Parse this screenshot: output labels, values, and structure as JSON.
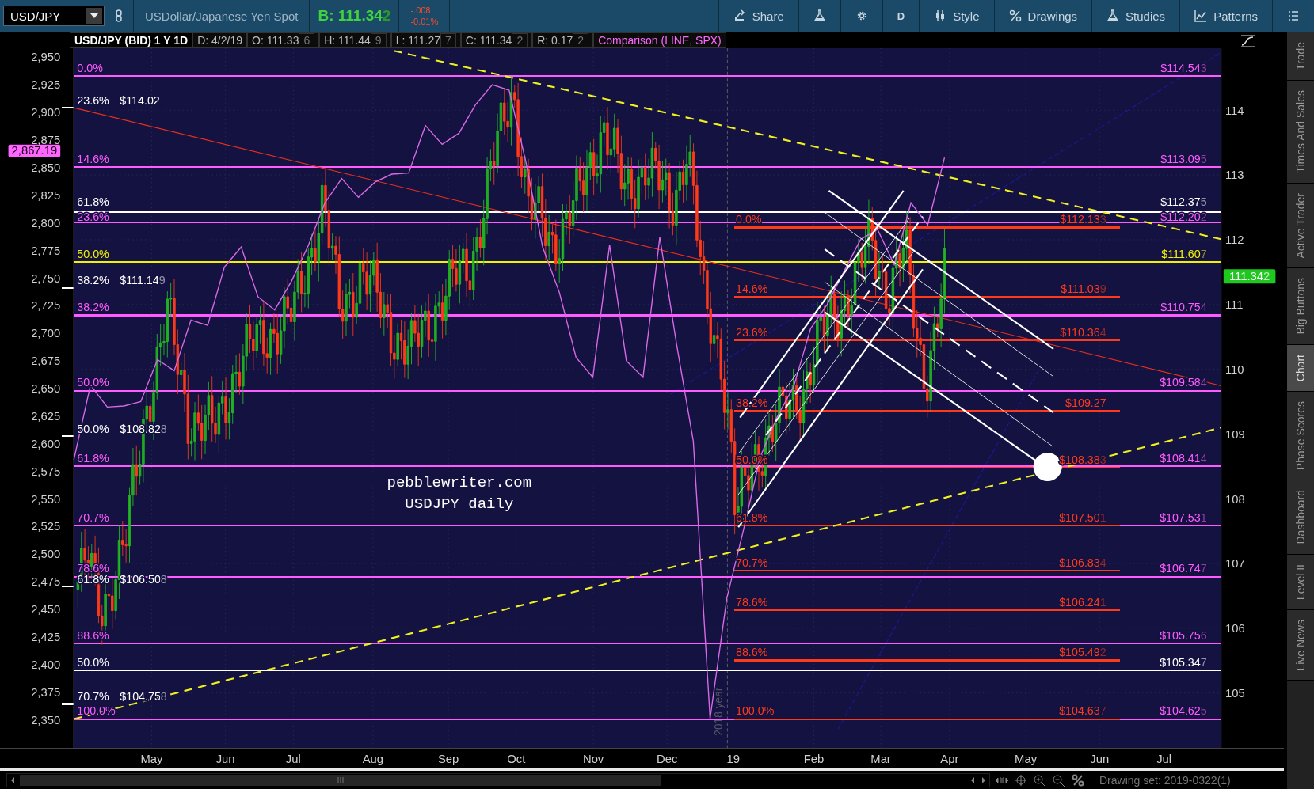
{
  "toolbar": {
    "symbol": "USD/JPY",
    "description": "USDollar/Japanese Yen Spot",
    "bid": {
      "text": "B: 111.34",
      "tail": "2"
    },
    "change": "-.008",
    "change_percent": "-0.01%",
    "buttons": [
      {
        "kind": "share",
        "label": "Share"
      },
      {
        "kind": "flask"
      },
      {
        "kind": "gear"
      },
      {
        "kind": "text",
        "label": "D"
      },
      {
        "kind": "style",
        "label": "Style"
      },
      {
        "kind": "drawings",
        "label": "Drawings"
      },
      {
        "kind": "studies",
        "label": "Studies"
      },
      {
        "kind": "patterns",
        "label": "Patterns"
      },
      {
        "kind": "menu"
      }
    ]
  },
  "header": {
    "title": "USD/JPY (BID) 1 Y 1D",
    "fields": [
      {
        "text": "D: 4/2/19"
      },
      {
        "text": "O: 111.33",
        "tail": "6"
      },
      {
        "text": "H: 111.44",
        "tail": "9"
      },
      {
        "text": "L: 111.27",
        "tail": "7"
      },
      {
        "text": "C: 111.34",
        "tail": "2"
      },
      {
        "text": "R: 0.17",
        "tail": "2"
      }
    ],
    "comparison": "Comparison (LINE, SPX)"
  },
  "chart": {
    "chart_data": {
      "type": "line",
      "ylim": [
        2324,
        2958
      ],
      "series": [
        {
          "color": "#d86ae6",
          "values": [
            2585,
            2653,
            2633,
            2634,
            2638,
            2676,
            2666,
            2712,
            2707,
            2760,
            2778,
            2733,
            2721,
            2747,
            2779,
            2818,
            2840,
            2823,
            2837,
            2844,
            2845,
            2888,
            2871,
            2881,
            2907,
            2925,
            2920,
            2855,
            2778,
            2737,
            2678,
            2660,
            2780,
            2675,
            2660,
            2787,
            2690,
            2602,
            2351,
            2460,
            2522,
            2588,
            2624,
            2652,
            2704,
            2726,
            2756,
            2785,
            2794,
            2762,
            2818,
            2798,
            2859
          ]
        }
      ],
      "yticks": [
        {
          "value": 2950,
          "label": "2,950"
        },
        {
          "value": 2925,
          "label": "2,925"
        },
        {
          "value": 2900,
          "label": "2,900"
        },
        {
          "value": 2875,
          "label": "2,875"
        },
        {
          "value": 2850,
          "label": "2,850"
        },
        {
          "value": 2825,
          "label": "2,825"
        },
        {
          "value": 2800,
          "label": "2,800"
        },
        {
          "value": 2775,
          "label": "2,775"
        },
        {
          "value": 2750,
          "label": "2,750"
        },
        {
          "value": 2725,
          "label": "2,725"
        },
        {
          "value": 2700,
          "label": "2,700"
        },
        {
          "value": 2675,
          "label": "2,675"
        },
        {
          "value": 2650,
          "label": "2,650"
        },
        {
          "value": 2625,
          "label": "2,625"
        },
        {
          "value": 2600,
          "label": "2,600"
        },
        {
          "value": 2575,
          "label": "2,575"
        },
        {
          "value": 2550,
          "label": "2,550"
        },
        {
          "value": 2525,
          "label": "2,525"
        },
        {
          "value": 2500,
          "label": "2,500"
        },
        {
          "value": 2475,
          "label": "2,475"
        },
        {
          "value": 2450,
          "label": "2,450"
        },
        {
          "value": 2425,
          "label": "2,425"
        },
        {
          "value": 2400,
          "label": "2,400"
        },
        {
          "value": 2375,
          "label": "2,375"
        },
        {
          "value": 2350,
          "label": "2,350"
        }
      ]
    },
    "right_axis_ticks": [
      "114",
      "113",
      "112",
      "111",
      "110",
      "109",
      "108",
      "107",
      "106",
      "105"
    ],
    "left_badge": {
      "text": "2,867.19"
    },
    "right_badge": {
      "text": "111.34",
      "tail": "2"
    },
    "date_labels": [
      "May",
      "Jun",
      "Jul",
      "Aug",
      "Sep",
      "Oct",
      "Nov",
      "Dec",
      "19",
      "Feb",
      "Mar",
      "Apr",
      "May",
      "Jun",
      "Jul"
    ],
    "notes": [
      "pebblewriter.com",
      "USDJPY daily"
    ],
    "year_marker": "2018 year",
    "fib_sets": [
      {
        "kind": "range",
        "color": "#ff5cff",
        "levels": [
          {
            "percent": "0.0%",
            "price": "$114.54",
            "tail": "3"
          },
          {
            "percent": "14.6%",
            "price": "$113.09",
            "tail": "5"
          },
          {
            "percent": "23.6%",
            "price": "$112.20",
            "tail": "2"
          },
          {
            "percent": "38.2%",
            "price": "$110.75",
            "tail": "4"
          },
          {
            "percent": "50.0%",
            "price": "$109.58",
            "tail": "4"
          },
          {
            "percent": "61.8%",
            "price": "$108.41",
            "tail": "4"
          },
          {
            "percent": "70.7%",
            "price": "$107.53",
            "tail": "1"
          },
          {
            "percent": "78.6%",
            "price": "$106.74",
            "tail": "7"
          },
          {
            "percent": "88.6%",
            "price": "$105.75",
            "tail": "6"
          },
          {
            "percent": "100.0%",
            "price": "$104.62",
            "tail": "5"
          }
        ]
      },
      {
        "kind": "range",
        "color": "#ff3a1a",
        "levels": [
          {
            "percent": "0.0%",
            "price": "$112.13",
            "tail": "3"
          },
          {
            "percent": "14.6%",
            "price": "$111.03",
            "tail": "9"
          },
          {
            "percent": "23.6%",
            "price": "$110.36",
            "tail": "4"
          },
          {
            "percent": "38.2%",
            "price": "$109.27"
          },
          {
            "percent": "50.0%",
            "price": "$108.38",
            "tail": "3"
          },
          {
            "percent": "61.8%",
            "price": "$107.50",
            "tail": "1"
          },
          {
            "percent": "70.7%",
            "price": "$106.83",
            "tail": "4"
          },
          {
            "percent": "78.6%",
            "price": "$106.24",
            "tail": "1"
          },
          {
            "percent": "88.6%",
            "price": "$105.49",
            "tail": "2"
          },
          {
            "percent": "100.0%",
            "price": "$104.63",
            "tail": "7"
          }
        ]
      },
      {
        "kind": "mixed",
        "levels": [
          {
            "kind": "tick",
            "color": "#ffffff",
            "percent": "23.6%",
            "price": "$114.02"
          },
          {
            "kind": "full",
            "color": "#ffffff",
            "percent": "61.8%",
            "price": "$112.37",
            "tail": "5"
          },
          {
            "kind": "full",
            "color": "#f2f200",
            "percent": "50.0%",
            "price": "$111.60",
            "tail": "7"
          },
          {
            "kind": "tick",
            "color": "#ffffff",
            "percent": "38.2%",
            "price": "$111.14",
            "tail": "9"
          },
          {
            "kind": "tick",
            "color": "#ffffff",
            "percent": "50.0%",
            "price": "$108.82",
            "tail": "8"
          },
          {
            "kind": "tick",
            "color": "#ffffff",
            "percent": "61.8%",
            "price": "$106.50",
            "tail": "8"
          },
          {
            "kind": "full",
            "color": "#ffffff",
            "percent": "50.0%",
            "price": "$105.34",
            "tail": "7"
          },
          {
            "kind": "tick",
            "color": "#ffffff",
            "percent": "70.7%",
            "price": "$104.75",
            "tail": "8"
          }
        ]
      }
    ]
  },
  "side_tabs": [
    {
      "label": "Trade",
      "selected": false
    },
    {
      "label": "Times And Sales",
      "selected": false
    },
    {
      "label": "Active Trader",
      "selected": false
    },
    {
      "label": "Big Buttons",
      "selected": false
    },
    {
      "label": "Chart",
      "selected": true
    },
    {
      "label": "Phase Scores",
      "selected": false
    },
    {
      "label": "Dashboard",
      "selected": false
    },
    {
      "label": "Level II",
      "selected": false
    },
    {
      "label": "Live News",
      "selected": false
    }
  ],
  "footer": {
    "drawing_set": "Drawing set: 2019-0322(1)"
  }
}
